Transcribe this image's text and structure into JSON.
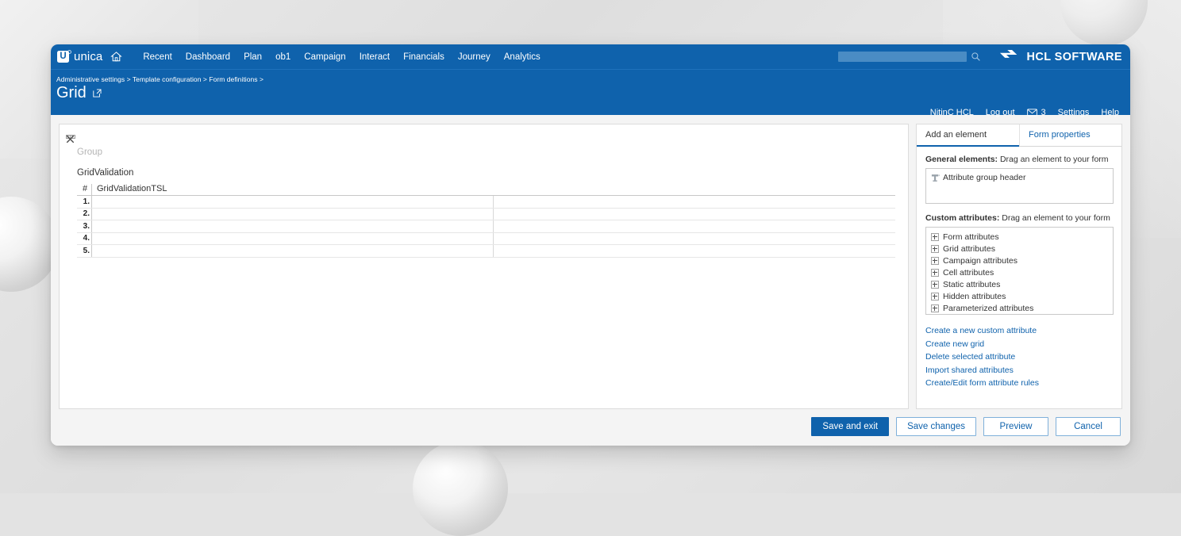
{
  "brand": {
    "mark_letter": "U",
    "name": "unica",
    "home_icon": "home-icon"
  },
  "nav": {
    "items": [
      {
        "label": "Recent"
      },
      {
        "label": "Dashboard"
      },
      {
        "label": "Plan"
      },
      {
        "label": "ob1"
      },
      {
        "label": "Campaign"
      },
      {
        "label": "Interact"
      },
      {
        "label": "Financials"
      },
      {
        "label": "Journey"
      },
      {
        "label": "Analytics"
      }
    ]
  },
  "search": {
    "value": "",
    "placeholder": "",
    "icon": "search-icon"
  },
  "vendor": {
    "logo_icon": "hcl-logo-icon",
    "text": "HCL SOFTWARE"
  },
  "header": {
    "breadcrumb": "Administrative settings > Template configuration > Form definitions >",
    "title": "Grid",
    "title_link_icon": "external-link-icon"
  },
  "account": {
    "user": "NitinC HCL",
    "logout": "Log out",
    "mail_icon": "mail-icon",
    "mail_count": "3",
    "settings": "Settings",
    "help": "Help"
  },
  "canvas": {
    "grip_icon": "drag-grip-icon",
    "close_icon": "close-icon",
    "group_label": "Group",
    "grid_name": "GridValidation",
    "grid": {
      "columns": [
        "#",
        "GridValidationTSL"
      ],
      "rows": [
        {
          "num": "1.",
          "cells": [
            "",
            ""
          ]
        },
        {
          "num": "2.",
          "cells": [
            "",
            ""
          ]
        },
        {
          "num": "3.",
          "cells": [
            "",
            ""
          ]
        },
        {
          "num": "4.",
          "cells": [
            "",
            ""
          ]
        },
        {
          "num": "5.",
          "cells": [
            "",
            ""
          ]
        }
      ]
    }
  },
  "panel": {
    "tabs": [
      {
        "label": "Add an element",
        "active": true
      },
      {
        "label": "Form properties",
        "active": false
      }
    ],
    "general_label_strong": "General elements:",
    "general_label_rest": " Drag an element to your form",
    "general_items": [
      {
        "label": "Attribute group header",
        "icon": "attribute-group-header-icon"
      }
    ],
    "custom_label_strong": "Custom attributes:",
    "custom_label_rest": " Drag an element to your form",
    "custom_items": [
      {
        "label": "Form attributes"
      },
      {
        "label": "Grid attributes"
      },
      {
        "label": "Campaign attributes"
      },
      {
        "label": "Cell attributes"
      },
      {
        "label": "Static attributes"
      },
      {
        "label": "Hidden attributes"
      },
      {
        "label": "Parameterized attributes"
      }
    ],
    "links": [
      {
        "label": "Create a new custom attribute"
      },
      {
        "label": "Create new grid"
      },
      {
        "label": "Delete selected attribute"
      },
      {
        "label": "Import shared attributes"
      },
      {
        "label": "Create/Edit form attribute rules"
      }
    ]
  },
  "footer": {
    "buttons": [
      {
        "label": "Save and exit",
        "style": "primary"
      },
      {
        "label": "Save changes",
        "style": "secondary"
      },
      {
        "label": "Preview",
        "style": "secondary"
      },
      {
        "label": "Cancel",
        "style": "secondary"
      }
    ]
  },
  "colors": {
    "brand_blue": "#0f62ac",
    "link_blue": "#0f62ac",
    "panel_bg": "#f4f4f4"
  }
}
